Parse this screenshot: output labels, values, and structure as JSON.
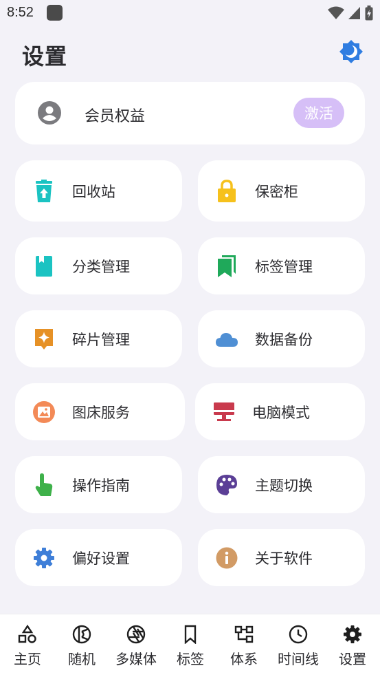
{
  "status_bar": {
    "time": "8:52"
  },
  "header": {
    "title": "设置"
  },
  "member": {
    "label": "会员权益",
    "activate_label": "激活"
  },
  "tiles": [
    {
      "label": "回收站",
      "icon": "recycle-bin-icon",
      "color": "#1bc3c2"
    },
    {
      "label": "保密柜",
      "icon": "lock-icon",
      "color": "#f6c11c"
    },
    {
      "label": "分类管理",
      "icon": "book-icon",
      "color": "#1bc3c2"
    },
    {
      "label": "标签管理",
      "icon": "bookmarks-icon",
      "color": "#1fa95a"
    },
    {
      "label": "碎片管理",
      "icon": "sparkle-chat-icon",
      "color": "#e69126"
    },
    {
      "label": "数据备份",
      "icon": "cloud-icon",
      "color": "#4f8fd4"
    },
    {
      "label": "图床服务",
      "icon": "image-icon",
      "color": "#f38a57"
    },
    {
      "label": "电脑模式",
      "icon": "desktop-icon",
      "color": "#c93a4d"
    },
    {
      "label": "操作指南",
      "icon": "touch-icon",
      "color": "#3eb14a"
    },
    {
      "label": "主题切换",
      "icon": "palette-icon",
      "color": "#5b3f96"
    },
    {
      "label": "偏好设置",
      "icon": "gear-icon",
      "color": "#3f7fd8"
    },
    {
      "label": "关于软件",
      "icon": "info-icon",
      "color": "#d29b65"
    }
  ],
  "nav": [
    {
      "label": "主页",
      "icon": "shapes-icon"
    },
    {
      "label": "随机",
      "icon": "random-icon"
    },
    {
      "label": "多媒体",
      "icon": "aperture-icon"
    },
    {
      "label": "标签",
      "icon": "bookmark-icon"
    },
    {
      "label": "体系",
      "icon": "hierarchy-icon"
    },
    {
      "label": "时间线",
      "icon": "clock-icon"
    },
    {
      "label": "设置",
      "icon": "gear-icon"
    }
  ]
}
